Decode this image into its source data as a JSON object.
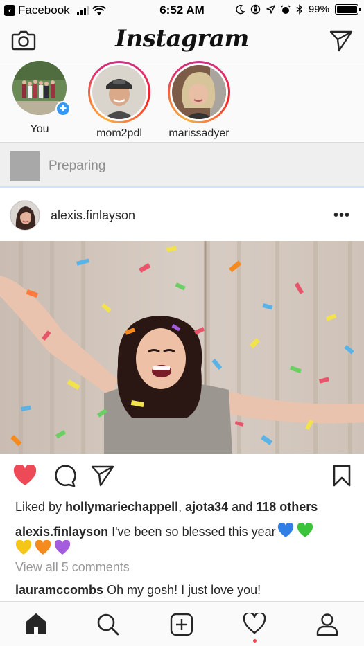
{
  "status_bar": {
    "back_app": "Facebook",
    "time": "6:52 AM",
    "battery": "99%"
  },
  "header": {
    "logo": "Instagram",
    "icons": [
      "camera-icon",
      "direct-message-icon"
    ]
  },
  "stories": [
    {
      "label": "You",
      "has_add_badge": true
    },
    {
      "label": "mom2pdl"
    },
    {
      "label": "marissadyer"
    }
  ],
  "upload": {
    "status": "Preparing"
  },
  "post": {
    "username": "alexis.finlayson",
    "more": "•••",
    "likes_prefix": "Liked by ",
    "liker1": "hollymariechappell",
    "likes_sep": ", ",
    "liker2": "ajota34",
    "likes_and": " and ",
    "others": "118 others",
    "caption_user": "alexis.finlayson",
    "caption_text": " I've been so blessed this year",
    "view_comments": "View all 5 comments",
    "comment_user": "lauramccombs",
    "comment_text": " Oh my gosh! I just love you!",
    "liked": true
  },
  "tabbar": {
    "items": [
      "home",
      "search",
      "new-post",
      "activity",
      "profile"
    ],
    "active": "home"
  },
  "colors": {
    "like_red": "#ed4956",
    "accent_blue": "#3897f0",
    "heart_blue": "#2f7fe6",
    "heart_green": "#3cc33c",
    "heart_yellow": "#f5c518",
    "heart_orange": "#f58a1f",
    "heart_purple": "#a55de0"
  }
}
